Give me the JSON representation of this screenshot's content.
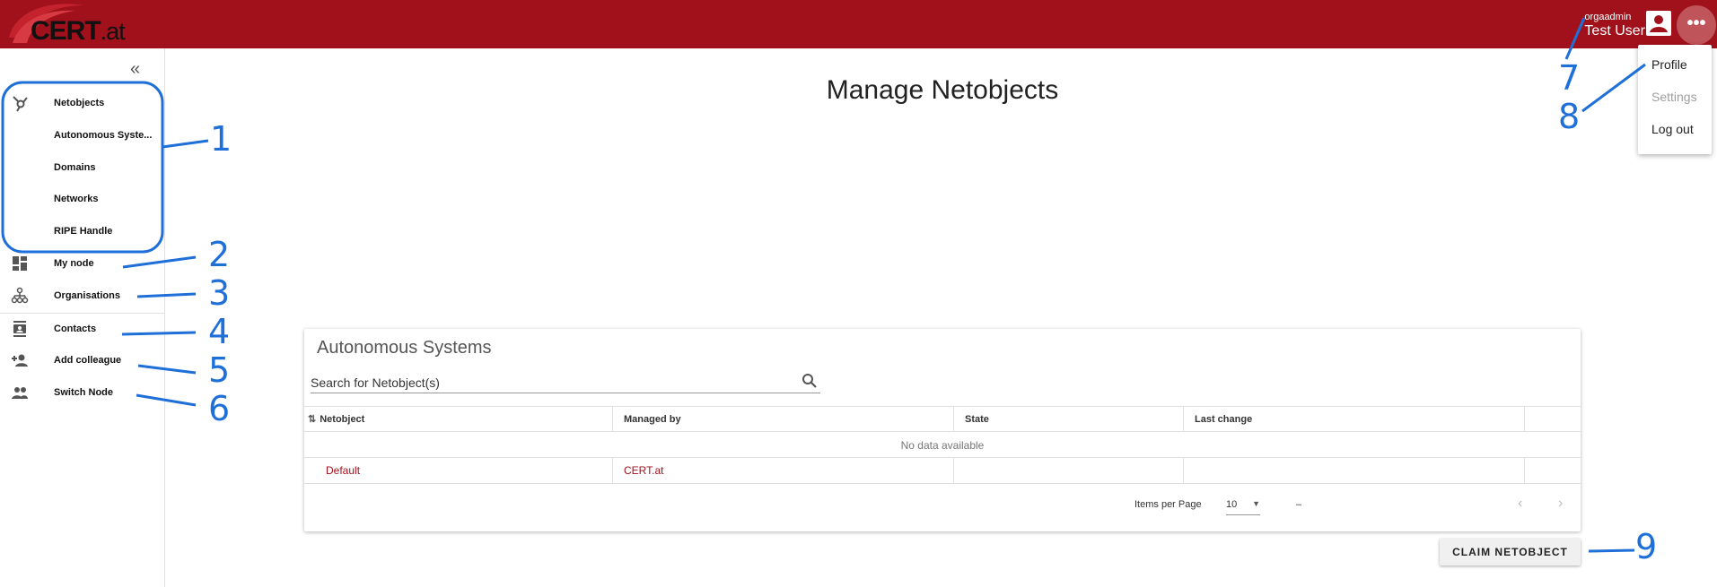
{
  "header": {
    "logo_main": "CERT",
    "logo_suffix": ".at",
    "user_role": "orgaadmin",
    "user_name": "Test User",
    "more_label": "•••",
    "color": "#a0111c"
  },
  "sidebar": {
    "collapse_label": "«",
    "items": [
      {
        "label": "Netobjects",
        "icon": "hub-icon"
      },
      {
        "label": "Autonomous Syste...",
        "icon": ""
      },
      {
        "label": "Domains",
        "icon": ""
      },
      {
        "label": "Networks",
        "icon": ""
      },
      {
        "label": "RIPE Handle",
        "icon": ""
      },
      {
        "label": "My node",
        "icon": "dashboard-icon"
      },
      {
        "label": "Organisations",
        "icon": "org-tree-icon"
      },
      {
        "label": "Contacts",
        "icon": "contacts-icon"
      },
      {
        "label": "Add colleague",
        "icon": "person-add-icon"
      },
      {
        "label": "Switch Node",
        "icon": "group-icon"
      }
    ]
  },
  "main": {
    "title": "Manage Netobjects",
    "card_title": "Autonomous Systems",
    "search_placeholder": "Search for Netobject(s)",
    "columns": [
      "Netobject",
      "Managed by",
      "State",
      "Last change"
    ],
    "no_data": "No data available",
    "rows": [
      {
        "netobject": "Default",
        "managed_by": "CERT.at",
        "state": "",
        "last_change": ""
      }
    ],
    "items_per_page_label": "Items per Page",
    "items_per_page_value": "10",
    "range_label": "–",
    "claim_button": "CLAIM NETOBJECT"
  },
  "menu": {
    "items": [
      "Profile",
      "Settings",
      "Log out"
    ]
  },
  "annotations": {
    "labels": [
      "1",
      "2",
      "3",
      "4",
      "5",
      "6",
      "7",
      "8",
      "9"
    ],
    "color": "#1f6fd8"
  }
}
